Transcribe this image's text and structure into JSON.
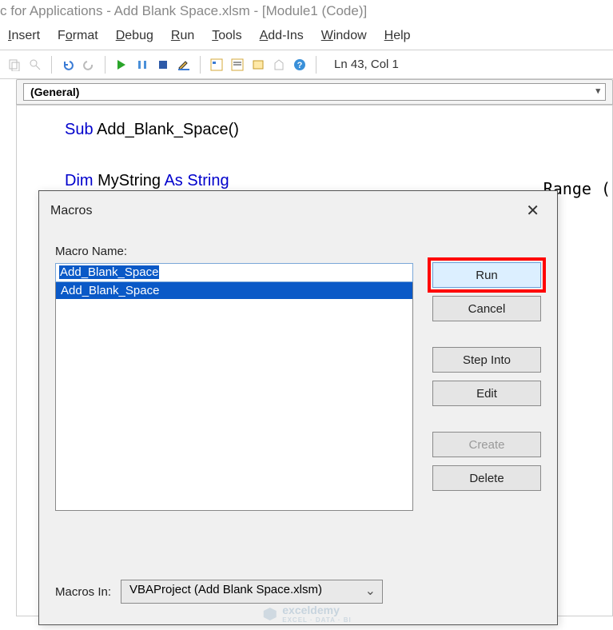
{
  "window": {
    "title": "c for Applications - Add Blank Space.xlsm - [Module1 (Code)]"
  },
  "menus": {
    "insert": "Insert",
    "format": "Format",
    "debug": "Debug",
    "run": "Run",
    "tools": "Tools",
    "addins": "Add-Ins",
    "window": "Window",
    "help": "Help"
  },
  "status": "Ln 43, Col 1",
  "dropdown": {
    "left": "(General)"
  },
  "code": {
    "l1a": "Sub",
    "l1b": " Add_Blank_Space()",
    "l2a": "Dim",
    "l2b": " MyString ",
    "l2c": "As String",
    "bg_frag": "Range ("
  },
  "dialog": {
    "title": "Macros",
    "macro_name_label": "Macro Name:",
    "macro_name_value": "Add_Blank_Space",
    "list_items": [
      "Add_Blank_Space"
    ],
    "macros_in_label": "Macros In:",
    "macros_in_value": "VBAProject (Add Blank Space.xlsm)",
    "buttons": {
      "run": "Run",
      "cancel": "Cancel",
      "step_into": "Step Into",
      "edit": "Edit",
      "create": "Create",
      "delete": "Delete"
    }
  },
  "watermark": {
    "brand": "exceldemy",
    "tag": "EXCEL · DATA · BI"
  }
}
